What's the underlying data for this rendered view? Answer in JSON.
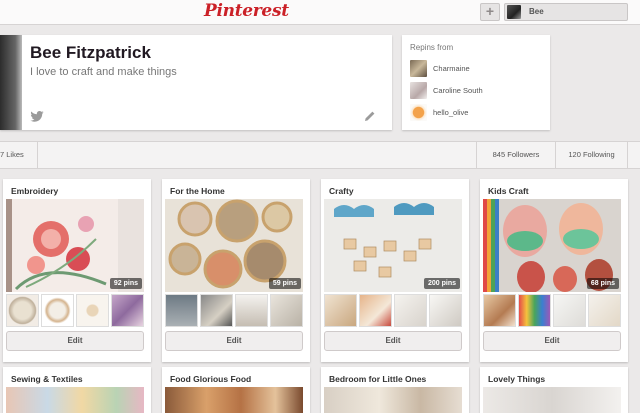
{
  "header": {
    "logo": "Pinterest",
    "add_label": "+",
    "user_name": "Bee"
  },
  "profile": {
    "name": "Bee Fitzpatrick",
    "bio": "I love to craft and make things"
  },
  "repins": {
    "title": "Repins from",
    "items": [
      {
        "name": "Charmaine"
      },
      {
        "name": "Caroline South"
      },
      {
        "name": "hello_olive"
      }
    ]
  },
  "stats": {
    "likes": "7 Likes",
    "followers": "845 Followers",
    "following": "120 Following"
  },
  "boards": [
    {
      "title": "Embroidery",
      "pins": "92 pins",
      "edit": "Edit"
    },
    {
      "title": "For the Home",
      "pins": "59 pins",
      "edit": "Edit"
    },
    {
      "title": "Crafty",
      "pins": "200 pins",
      "edit": "Edit"
    },
    {
      "title": "Kids Craft",
      "pins": "68 pins",
      "edit": "Edit"
    },
    {
      "title": "Sewing & Textiles"
    },
    {
      "title": "Food Glorious Food"
    },
    {
      "title": "Bedroom for Little Ones"
    },
    {
      "title": "Lovely Things"
    }
  ],
  "colors": {
    "brand": "#cb2027",
    "background": "#ebe9e9"
  }
}
